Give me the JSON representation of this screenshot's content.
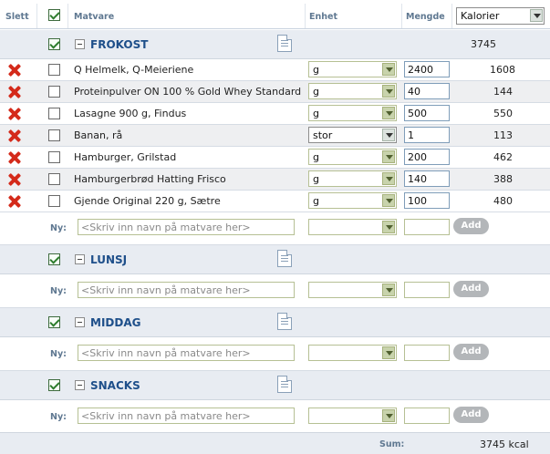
{
  "header": {
    "delete_label": "Slett",
    "food_label": "Matvare",
    "unit_label": "Enhet",
    "amount_label": "Mengde",
    "nutrient_select": "Kalorier"
  },
  "meals": [
    {
      "name": "FROKOST",
      "total": "3745",
      "items": [
        {
          "name": "Q Helmelk, Q-Meieriene",
          "unit": "g",
          "amount": "2400",
          "value": "1608"
        },
        {
          "name": "Proteinpulver ON 100 % Gold Whey Standard",
          "unit": "g",
          "amount": "40",
          "value": "144"
        },
        {
          "name": "Lasagne 900 g, Findus",
          "unit": "g",
          "amount": "500",
          "value": "550"
        },
        {
          "name": "Banan, rå",
          "unit": "stor",
          "amount": "1",
          "value": "113"
        },
        {
          "name": "Hamburger, Grilstad",
          "unit": "g",
          "amount": "200",
          "value": "462"
        },
        {
          "name": "Hamburgerbrød Hatting Frisco",
          "unit": "g",
          "amount": "140",
          "value": "388"
        },
        {
          "name": "Gjende Original 220 g, Sætre",
          "unit": "g",
          "amount": "100",
          "value": "480"
        }
      ]
    },
    {
      "name": "LUNSJ",
      "total": "",
      "items": []
    },
    {
      "name": "MIDDAG",
      "total": "",
      "items": []
    },
    {
      "name": "SNACKS",
      "total": "",
      "items": []
    }
  ],
  "new_row": {
    "label": "Ny:",
    "placeholder": "<Skriv inn navn på matvare her>",
    "add_label": "Add"
  },
  "footer": {
    "sum_label": "Sum:",
    "sum_value": "3745 kcal"
  },
  "colors": {
    "band": "#e8ecf2",
    "meal_name": "#1e4f8a",
    "delete": "#d42a1a"
  },
  "icons": {
    "delete": "red-x-icon",
    "collapse": "minus-box-icon",
    "details": "document-icon"
  }
}
